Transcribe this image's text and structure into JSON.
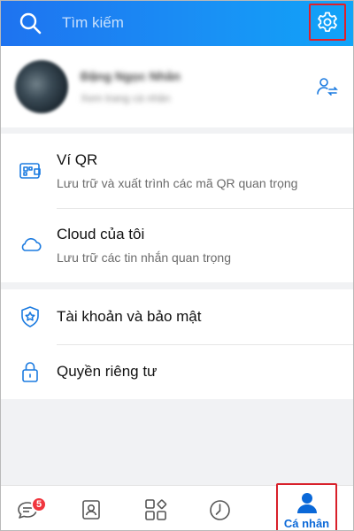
{
  "header": {
    "search_placeholder": "Tìm kiếm",
    "search_icon": "search-icon",
    "settings_icon": "gear-icon"
  },
  "profile": {
    "name": "Đặng Ngọc Nhân",
    "subtitle": "Xem trang cá nhân",
    "action_icon": "switch-account-icon"
  },
  "sections": [
    {
      "items": [
        {
          "icon": "qr-wallet-icon",
          "title": "Ví QR",
          "desc": "Lưu trữ và xuất trình các mã QR quan trọng"
        },
        {
          "icon": "cloud-icon",
          "title": "Cloud của tôi",
          "desc": "Lưu trữ các tin nhắn quan trọng"
        }
      ]
    },
    {
      "items": [
        {
          "icon": "shield-icon",
          "title": "Tài khoản và bảo mật"
        },
        {
          "icon": "lock-icon",
          "title": "Quyền riêng tư"
        }
      ]
    }
  ],
  "bottom_nav": {
    "messages_badge": "5",
    "active_label": "Cá nhân",
    "tabs": [
      "messages-icon",
      "contacts-icon",
      "discover-icon",
      "timeline-icon",
      "profile-icon"
    ]
  },
  "colors": {
    "header_start": "#1e73f0",
    "header_end": "#10a4f8",
    "accent": "#0a68d8",
    "highlight_box": "#e0202a",
    "badge": "#f0363e",
    "icon_blue": "#1c7be0"
  }
}
